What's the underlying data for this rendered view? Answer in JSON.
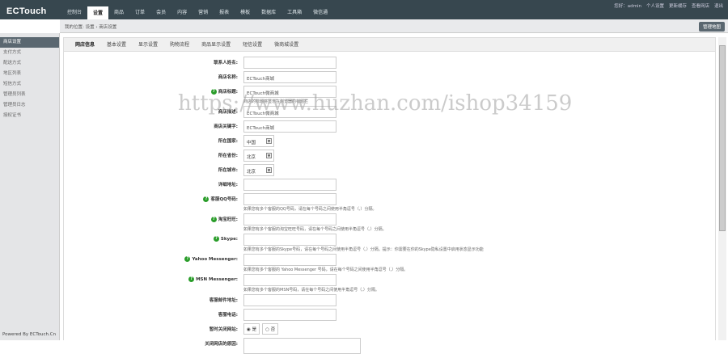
{
  "logo": "ECTouch",
  "nav": [
    "控制台",
    "设置",
    "商品",
    "订单",
    "会员",
    "内容",
    "营销",
    "报表",
    "模板",
    "数据库",
    "工具箱",
    "微信通"
  ],
  "user": [
    "您好：admin",
    "个人设置",
    "更新缓存",
    "查看网店",
    "退出"
  ],
  "breadcrumb": "我的位置: 设置 › 商店设置",
  "sitemap": "管理地图",
  "sidebar": [
    "商店设置",
    "支付方式",
    "配送方式",
    "地区列表",
    "短信方式",
    "管理员列表",
    "管理员日志",
    "授权证书"
  ],
  "powered": "Powered By ECTouch.Cn",
  "tabs": [
    "网店信息",
    "基本设置",
    "显示设置",
    "购物流程",
    "商品显示设置",
    "短信设置",
    "微商城设置"
  ],
  "form": {
    "contact": {
      "label": "联系人姓名:",
      "value": ""
    },
    "shop_name": {
      "label": "商店名称:",
      "value": "ECTouch商城"
    },
    "shop_title": {
      "label": "商店标题:",
      "value": "ECTouch微商城",
      "tip": "商店的标题将显示在浏览器的标题栏"
    },
    "shop_desc": {
      "label": "商店描述:",
      "value": "ECTouch微商城"
    },
    "keywords": {
      "label": "商店关键字:",
      "value": "ECTouch商城"
    },
    "country": {
      "label": "所在国家:",
      "value": "中国"
    },
    "province": {
      "label": "所在省份:",
      "value": "北京"
    },
    "city": {
      "label": "所在城市:",
      "value": "北京"
    },
    "address": {
      "label": "详细地址:",
      "value": ""
    },
    "qq": {
      "label": "客服QQ号码:",
      "tip": "如果您有多个客服的QQ号码，请在每个号码之间使用半角逗号（,）分隔。"
    },
    "ww": {
      "label": "淘宝旺旺:",
      "tip": "如果您有多个客服的淘宝旺旺号码，请在每个号码之间使用半角逗号（,）分隔。"
    },
    "skype": {
      "label": "Skype:",
      "tip": "如果您有多个客服的Skype号码，请在每个号码之间使用半角逗号（,）分隔。提示：你需要在你的Skype隐私设置中启用状态显示功能"
    },
    "yahoo": {
      "label": "Yahoo Messenger:",
      "tip": "如果您有多个客服的 Yahoo Messenger 号码，请在每个号码之间使用半角逗号（,）分隔。"
    },
    "msn": {
      "label": "MSN Messenger:",
      "tip": "如果您有多个客服的MSN号码，请在每个号码之间使用半角逗号（,）分隔。"
    },
    "email": {
      "label": "客服邮件地址:"
    },
    "phone": {
      "label": "客服电话:"
    },
    "closed": {
      "label": "暂时关闭网站:",
      "yes": "是",
      "no": "否",
      "selected": "yes"
    },
    "close_reason": {
      "label": "关闭网店的原因:"
    }
  },
  "watermark": "https://www.huzhan.com/ishop34159"
}
